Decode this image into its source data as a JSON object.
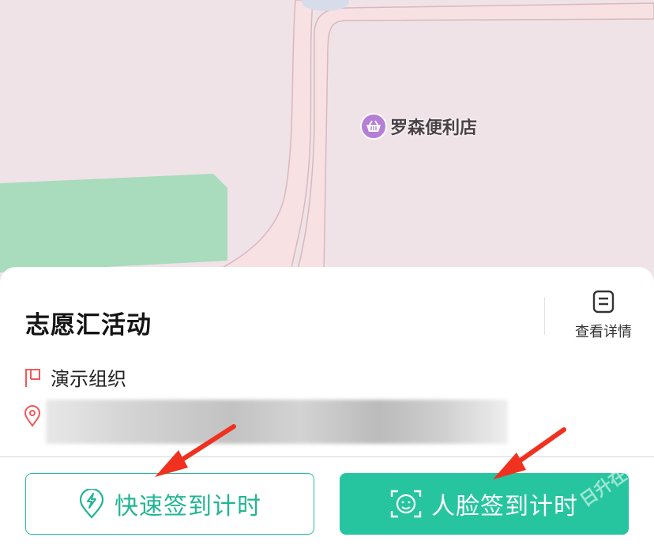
{
  "map": {
    "poi_name": "罗森便利店",
    "poi_icon": "shopping-basket-icon",
    "colors": {
      "land": "#efe3e8",
      "road": "#fbe6e6",
      "park": "#a9dbbd",
      "poi": "#b57fd6"
    }
  },
  "activity": {
    "title": "志愿汇活动",
    "organization": "演示组织",
    "address": "",
    "detail_label": "查看详情"
  },
  "actions": {
    "quick_checkin_label": "快速签到计时",
    "face_checkin_label": "人脸签到计时"
  },
  "watermark": "日升在",
  "colors": {
    "accent": "#26c59f",
    "arrow": "#f0311f",
    "flag": "#f05a5a"
  }
}
